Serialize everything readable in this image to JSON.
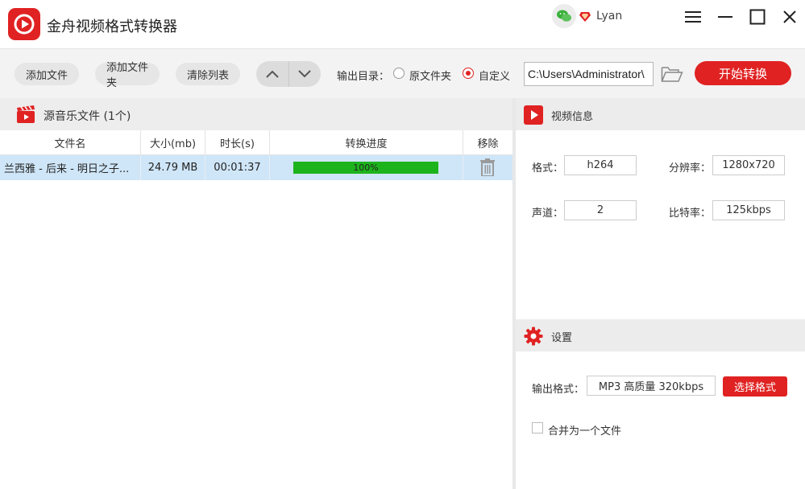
{
  "app": {
    "title": "金舟视频格式转换器"
  },
  "user": {
    "name": "Lyan"
  },
  "toolbar": {
    "add_file": "添加文件",
    "add_folder": "添加文件夹",
    "clear_list": "清除列表",
    "output_dir_label": "输出目录：",
    "option_original": "原文件夹",
    "option_custom": "自定义",
    "selected_option": "自定义",
    "output_path": "C:\\Users\\Administrator\\",
    "start_button": "开始转换"
  },
  "file_panel": {
    "title": "源音乐文件 (1个)",
    "columns": [
      "文件名",
      "大小(mb)",
      "时长(s)",
      "转换进度",
      "移除"
    ],
    "rows": [
      {
        "name": "兰西雅 - 后来 - 明日之子...",
        "size": "24.79 MB",
        "duration": "00:01:37",
        "progress": 1.0,
        "progress_label": "100%"
      }
    ]
  },
  "video_info": {
    "title": "视频信息",
    "format_label": "格式：",
    "format_value": "h264",
    "resolution_label": "分辨率：",
    "resolution_value": "1280x720",
    "channel_label": "声道：",
    "channel_value": "2",
    "bitrate_label": "比特率：",
    "bitrate_value": "125kbps"
  },
  "settings": {
    "title": "设置",
    "output_format_label": "输出格式：",
    "output_format_value": "MP3 高质量 320kbps",
    "choose_format_button": "选择格式",
    "merge_label": "合并为一个文件",
    "merge_checked": false
  },
  "colors": {
    "accent": "#e02222",
    "progress": "#1db31d",
    "row_selected": "#cfe6f8"
  }
}
